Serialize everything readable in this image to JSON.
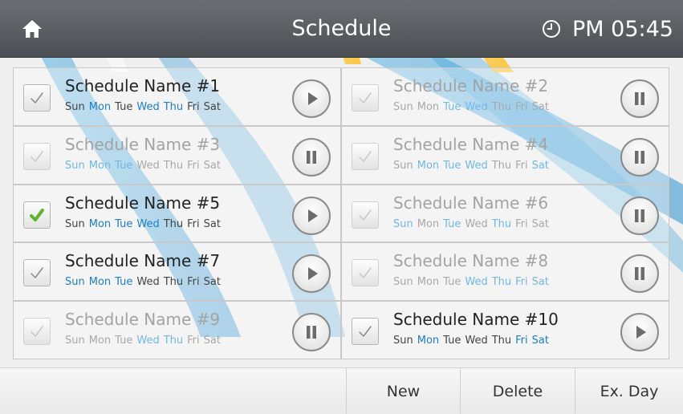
{
  "header": {
    "title": "Schedule",
    "time": "PM 05:45",
    "home_icon": "home-icon",
    "clock_icon": "clock-icon"
  },
  "day_labels": [
    "Sun",
    "Mon",
    "Tue",
    "Wed",
    "Thu",
    "Fri",
    "Sat"
  ],
  "colors": {
    "active_day": "#1d7ec9",
    "inactive_day": "#6fb7e6",
    "checked": "#5cb32c"
  },
  "schedules": [
    {
      "name": "Schedule Name #1",
      "enabled": true,
      "checked": false,
      "days": [
        false,
        true,
        false,
        true,
        true,
        false,
        false
      ],
      "control": "play"
    },
    {
      "name": "Schedule Name #2",
      "enabled": false,
      "checked": false,
      "days": [
        false,
        false,
        true,
        true,
        false,
        false,
        false
      ],
      "control": "pause"
    },
    {
      "name": "Schedule Name #3",
      "enabled": false,
      "checked": false,
      "days": [
        true,
        true,
        true,
        false,
        false,
        false,
        false
      ],
      "control": "pause"
    },
    {
      "name": "Schedule Name #4",
      "enabled": false,
      "checked": false,
      "days": [
        false,
        true,
        true,
        true,
        false,
        false,
        true
      ],
      "control": "pause"
    },
    {
      "name": "Schedule Name #5",
      "enabled": true,
      "checked": true,
      "days": [
        false,
        true,
        true,
        true,
        false,
        false,
        false
      ],
      "control": "play"
    },
    {
      "name": "Schedule Name #6",
      "enabled": false,
      "checked": false,
      "days": [
        true,
        false,
        true,
        false,
        true,
        false,
        false
      ],
      "control": "pause"
    },
    {
      "name": "Schedule Name #7",
      "enabled": true,
      "checked": false,
      "days": [
        true,
        true,
        true,
        false,
        false,
        false,
        false
      ],
      "control": "play"
    },
    {
      "name": "Schedule Name #8",
      "enabled": false,
      "checked": false,
      "days": [
        false,
        false,
        false,
        true,
        true,
        true,
        true
      ],
      "control": "pause"
    },
    {
      "name": "Schedule Name #9",
      "enabled": false,
      "checked": false,
      "days": [
        false,
        false,
        false,
        true,
        true,
        false,
        false
      ],
      "control": "pause"
    },
    {
      "name": "Schedule Name #10",
      "enabled": true,
      "checked": false,
      "days": [
        false,
        true,
        false,
        false,
        false,
        true,
        true
      ],
      "control": "play"
    }
  ],
  "bottom_bar": {
    "new_label": "New",
    "delete_label": "Delete",
    "exday_label": "Ex. Day"
  }
}
